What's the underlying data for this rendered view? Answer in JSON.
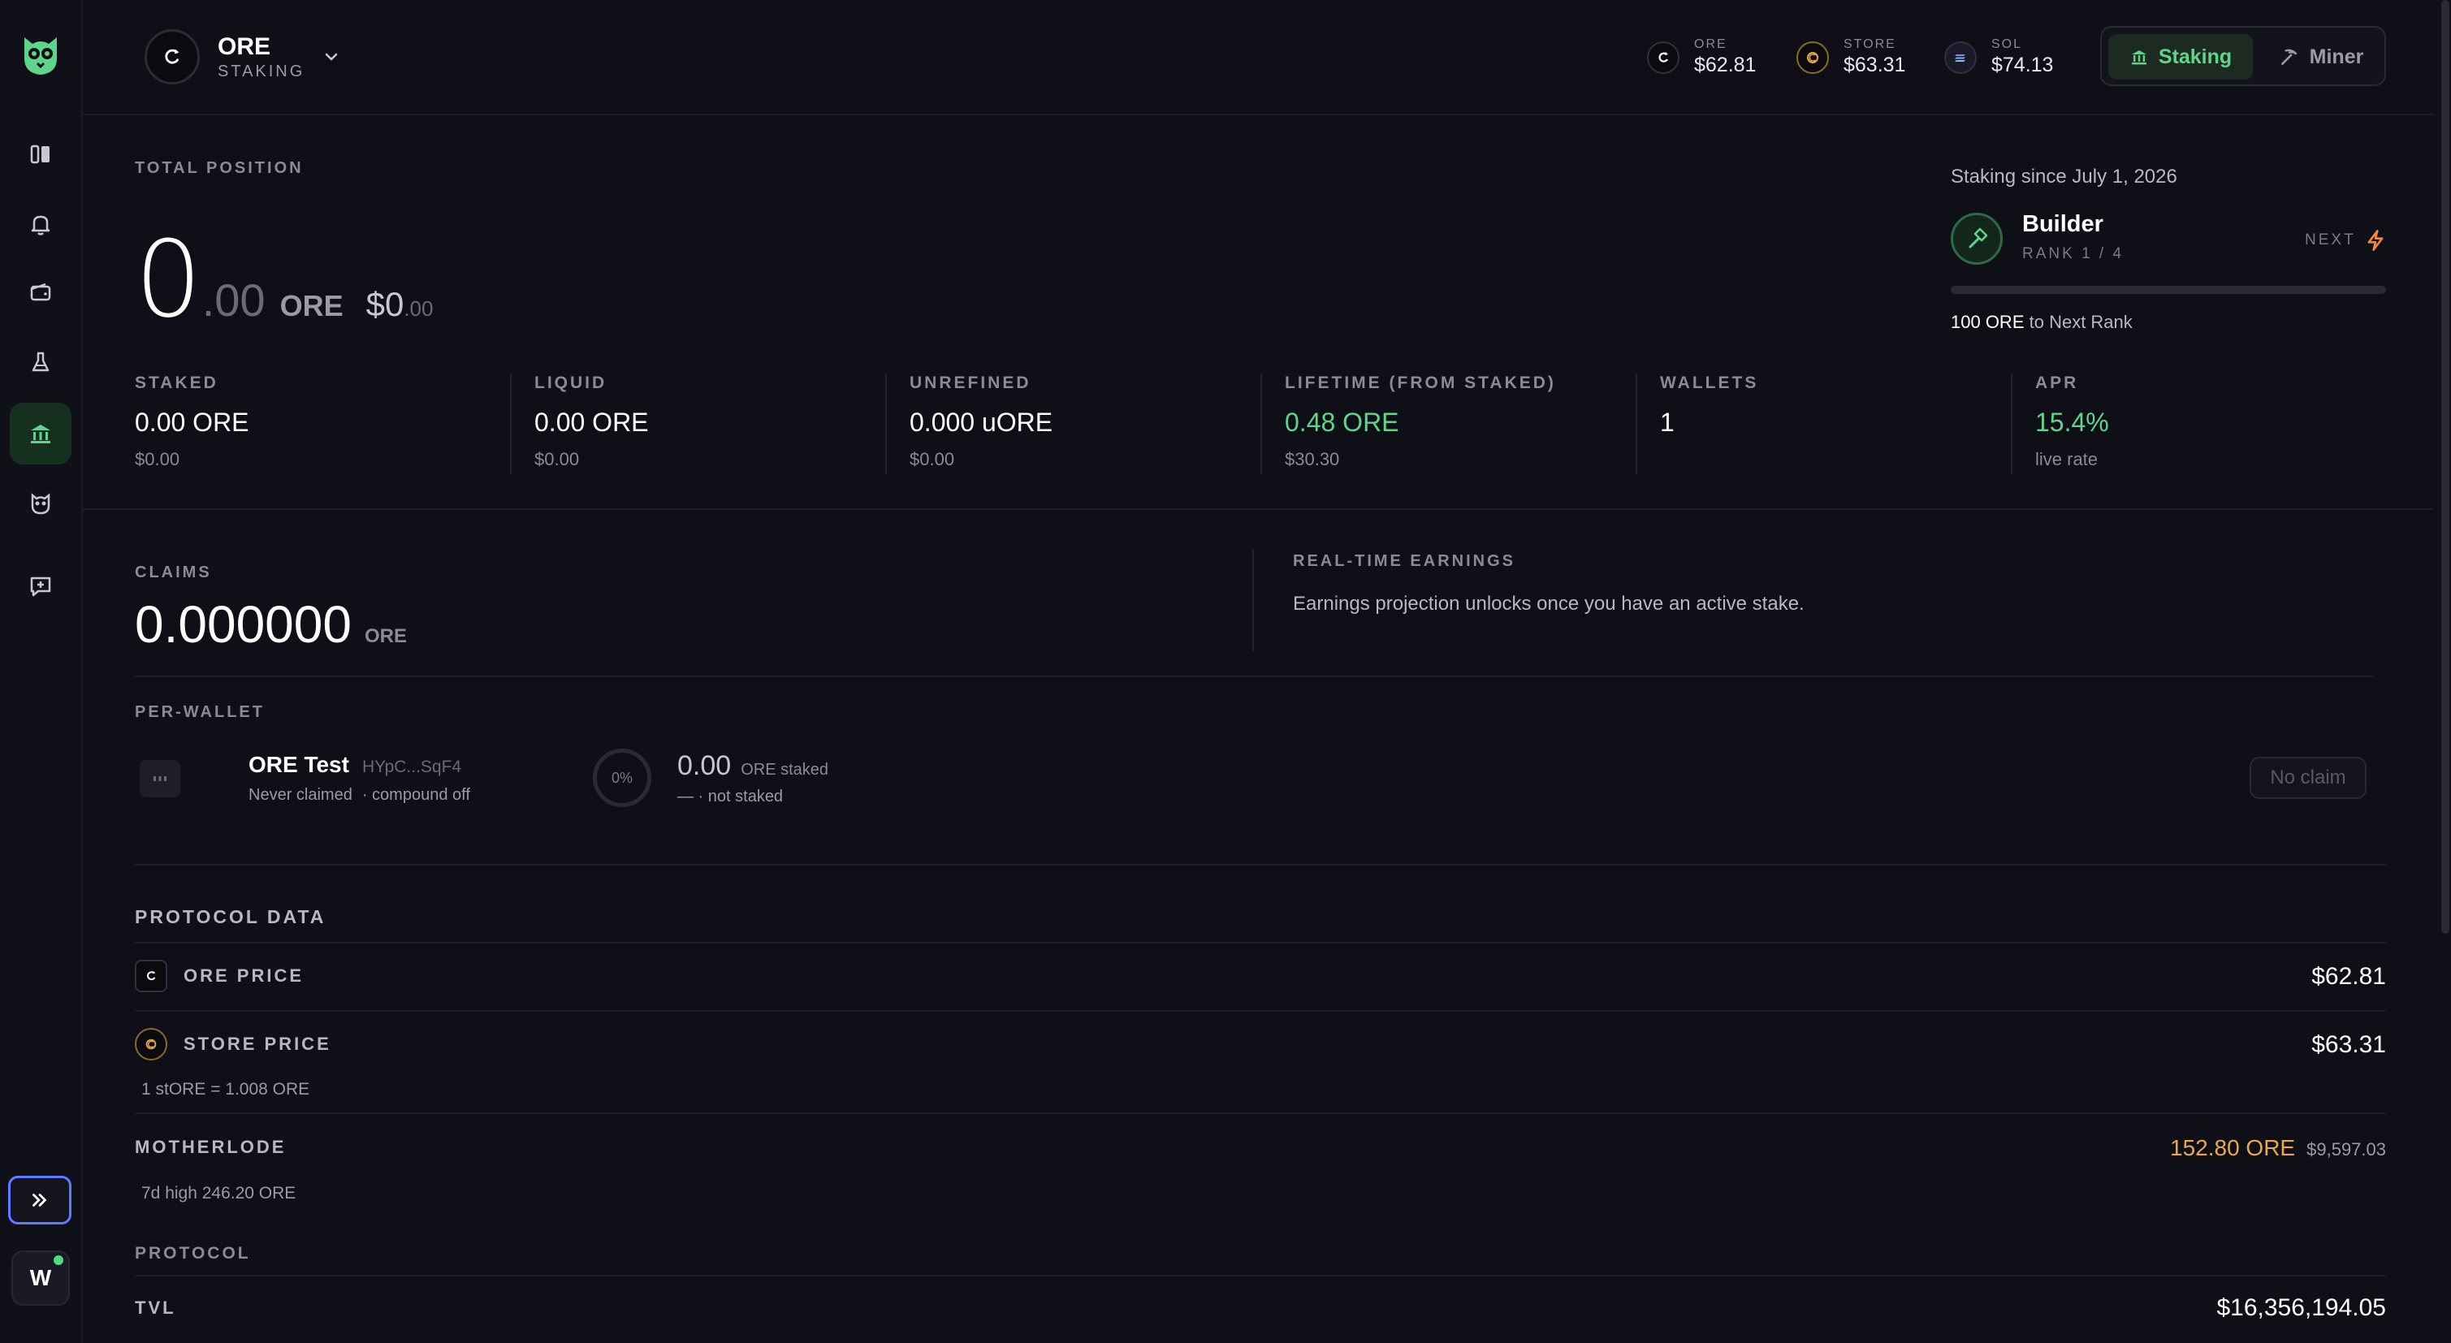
{
  "sidebar": {
    "logo": "owl-logo",
    "items": [
      {
        "icon": "dashboard-icon",
        "active": false
      },
      {
        "icon": "bell-icon",
        "active": false
      },
      {
        "icon": "wallet-icon",
        "active": false
      },
      {
        "icon": "flask-icon",
        "active": false
      },
      {
        "icon": "bank-icon",
        "active": true
      },
      {
        "icon": "owl-icon",
        "active": false
      },
      {
        "icon": "chat-plus-icon",
        "active": false
      }
    ],
    "expand_icon": "double-chevron-right-icon",
    "user_initial": "W"
  },
  "header": {
    "token_name": "ORE",
    "token_sub": "STAKING",
    "prices": [
      {
        "label": "ORE",
        "value": "$62.81",
        "icon": "ore-icon"
      },
      {
        "label": "STORE",
        "value": "$63.31",
        "icon": "store-icon"
      },
      {
        "label": "SOL",
        "value": "$74.13",
        "icon": "sol-icon"
      }
    ],
    "modes": {
      "staking": "Staking",
      "miner": "Miner"
    }
  },
  "position": {
    "label": "TOTAL POSITION",
    "int": "0",
    "dec": ".00",
    "unit": "ORE",
    "usd": "$0",
    "usd_dec": ".00"
  },
  "rank": {
    "since": "Staking since July 1, 2026",
    "name": "Builder",
    "rank_text": "RANK 1 / 4",
    "next_label": "NEXT",
    "progress_strong": "100 ORE",
    "progress_rest": " to Next Rank",
    "progress": 0
  },
  "stats": [
    {
      "label": "STAKED",
      "value": "0.00 ORE",
      "sub": "$0.00",
      "accent": false
    },
    {
      "label": "LIQUID",
      "value": "0.00 ORE",
      "sub": "$0.00",
      "accent": false
    },
    {
      "label": "UNREFINED",
      "value": "0.000 uORE",
      "sub": "$0.00",
      "accent": false
    },
    {
      "label": "LIFETIME (FROM STAKED)",
      "value": "0.48 ORE",
      "sub": "$30.30",
      "accent": true
    },
    {
      "label": "WALLETS",
      "value": "1",
      "sub": "",
      "accent": false
    },
    {
      "label": "APR",
      "value": "15.4%",
      "sub": "live rate",
      "accent": true
    }
  ],
  "claims": {
    "label": "CLAIMS",
    "value": "0.000000",
    "unit": "ORE",
    "realtime_label": "REAL-TIME EARNINGS",
    "realtime_text": "Earnings projection unlocks once you have an active stake."
  },
  "per_wallet": {
    "label": "PER-WALLET",
    "wallet_name": "ORE Test",
    "wallet_addr": "HYpC...SqF4",
    "claimed": "Never claimed",
    "compound": "· compound off",
    "pct": "0%",
    "staked_value": "0.00",
    "staked_unit": "ORE staked",
    "staked_status": "— · not staked",
    "claim_button": "No claim"
  },
  "protocol": {
    "title": "PROTOCOL DATA",
    "ore_price_label": "ORE PRICE",
    "ore_price": "$62.81",
    "store_price_label": "STORE PRICE",
    "store_price": "$63.31",
    "store_ratio": "1 stORE = 1.008 ORE",
    "motherlode_label": "MOTHERLODE",
    "motherlode_ore": "152.80 ORE",
    "motherlode_usd": "$9,597.03",
    "motherlode_high": "7d high 246.20 ORE",
    "protocol_label": "PROTOCOL",
    "tvl_label": "TVL",
    "tvl_value": "$16,356,194.05"
  },
  "colors": {
    "accent_green": "#5fd48b",
    "accent_orange": "#e8a94a",
    "background": "#0f0f17"
  }
}
